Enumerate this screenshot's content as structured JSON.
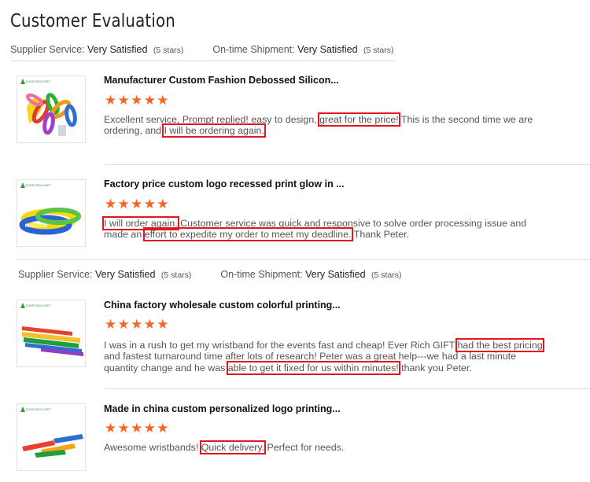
{
  "title": "Customer Evaluation",
  "summary_top": {
    "supplier_label": "Supplier Service:",
    "supplier_value": "Very Satisfied",
    "supplier_stars": "(5 stars)",
    "shipment_label": "On-time Shipment:",
    "shipment_value": "Very Satisfied",
    "shipment_stars": "(5 stars)"
  },
  "summary_mid": {
    "supplier_label": "Supplier Service:",
    "supplier_value": "Very Satisfied",
    "supplier_stars": "(5 stars)",
    "shipment_label": "On-time Shipment:",
    "shipment_value": "Very Satisfied",
    "shipment_stars": "(5 stars)"
  },
  "brand_logo_text": "EVER RICH GIFT",
  "rating_star_color": "#f26522",
  "highlight_color": "#e2161c",
  "reviews": [
    {
      "title": "Manufacturer Custom Fashion Debossed Silicon...",
      "rating": 5,
      "text_parts": [
        {
          "t": "Excellent service, Prompt replied! easy to design, ",
          "hl": false
        },
        {
          "t": "great for the price!",
          "hl": true
        },
        {
          "t": " This is the second time we are ordering, and ",
          "hl": false
        },
        {
          "t": "I will be ordering again.",
          "hl": true
        }
      ]
    },
    {
      "title": "Factory price custom logo recessed print glow in ...",
      "rating": 5,
      "text_parts": [
        {
          "t": "I will order again.",
          "hl": true
        },
        {
          "t": " Customer service was quick and responsive to solve order processing issue and made an ",
          "hl": false
        },
        {
          "t": "effort to expedite my order to meet my deadline.",
          "hl": true
        },
        {
          "t": " Thank Peter.",
          "hl": false
        }
      ]
    },
    {
      "title": "China factory wholesale custom colorful printing...",
      "rating": 5,
      "text_parts": [
        {
          "t": "I was in a rush to get my wristband for the events fast and cheap! Ever Rich GIFT ",
          "hl": false
        },
        {
          "t": "had the best pricing",
          "hl": true
        },
        {
          "t": " and fastest turnaround time after lots of research! Peter was a great help---we had a last minute quantity change and he was ",
          "hl": false
        },
        {
          "t": "able to get it fixed for us within minutes!",
          "hl": true
        },
        {
          "t": " thank you Peter.",
          "hl": false
        }
      ]
    },
    {
      "title": "Made in china custom personalized logo printing...",
      "rating": 5,
      "text_parts": [
        {
          "t": "Awesome wristbands! ",
          "hl": false
        },
        {
          "t": "Quick delivery.",
          "hl": true
        },
        {
          "t": " Perfect for needs.",
          "hl": false
        }
      ]
    }
  ]
}
